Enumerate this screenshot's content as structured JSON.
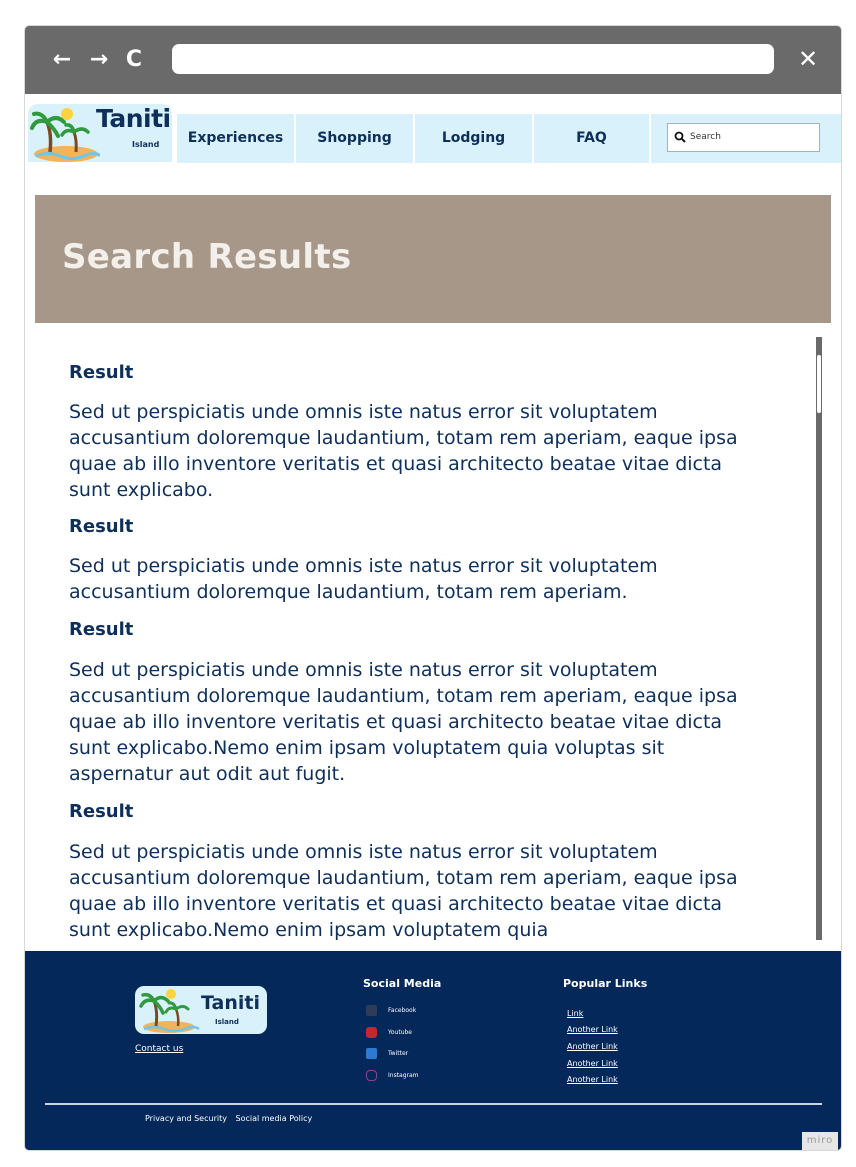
{
  "browser": {
    "back_icon": "←",
    "forward_icon": "→",
    "reload_icon": "C",
    "close_icon": "✕",
    "address_value": ""
  },
  "logo": {
    "name": "Taniti",
    "subtitle": "Island"
  },
  "nav": {
    "items": [
      {
        "label": "Experiences"
      },
      {
        "label": "Shopping"
      },
      {
        "label": "Lodging"
      },
      {
        "label": "FAQ"
      }
    ],
    "search_placeholder": "Search"
  },
  "hero": {
    "title": "Search Results"
  },
  "results": [
    {
      "heading": "Result",
      "body": "Sed ut perspiciatis unde omnis iste natus error sit voluptatem accusantium doloremque laudantium, totam rem aperiam, eaque ipsa quae ab illo inventore veritatis et quasi architecto beatae vitae dicta sunt explicabo."
    },
    {
      "heading": "Result",
      "body": "Sed ut perspiciatis unde omnis iste natus error sit voluptatem accusantium doloremque laudantium, totam rem aperiam."
    },
    {
      "heading": "Result",
      "body": "Sed ut perspiciatis unde omnis iste natus error sit voluptatem accusantium doloremque laudantium, totam rem aperiam, eaque ipsa quae ab illo inventore veritatis et quasi architecto beatae vitae dicta sunt explicabo.Nemo enim ipsam voluptatem quia voluptas sit aspernatur aut odit aut fugit."
    },
    {
      "heading": "Result",
      "body": "Sed ut perspiciatis unde omnis iste natus error sit voluptatem accusantium doloremque laudantium, totam rem aperiam, eaque ipsa quae ab illo inventore veritatis et quasi architecto beatae vitae dicta sunt explicabo.Nemo enim ipsam voluptatem quia"
    }
  ],
  "footer": {
    "contact_label": "Contact us",
    "social_title": "Social Media",
    "social": [
      {
        "label": "Facebook",
        "icon": "facebook-icon"
      },
      {
        "label": "Youtube",
        "icon": "youtube-icon"
      },
      {
        "label": "Twitter",
        "icon": "twitter-icon"
      },
      {
        "label": "Instagram",
        "icon": "instagram-icon"
      }
    ],
    "popular_title": "Popular Links",
    "popular": [
      "Link",
      "Another Link",
      "Another Link",
      "Another Link",
      "Another Link"
    ],
    "legal": [
      "Privacy and Security",
      "Social media Policy"
    ]
  },
  "watermark": "miro",
  "colors": {
    "navy": "#0e2f5a",
    "footer_bg": "#05285b",
    "nav_bg": "#d8f1fa",
    "hero_bg": "#a69788",
    "chrome_bg": "#6a6a6a"
  }
}
